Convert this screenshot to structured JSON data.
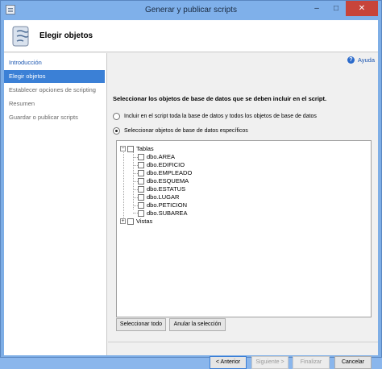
{
  "window": {
    "title": "Generar y publicar scripts",
    "minimize": "–",
    "maximize": "□",
    "close": "✕"
  },
  "header": {
    "title": "Elegir objetos",
    "icon": "script-scroll-icon"
  },
  "sidebar": {
    "items": [
      {
        "label": "Introducción",
        "state": "link"
      },
      {
        "label": "Elegir objetos",
        "state": "active"
      },
      {
        "label": "Establecer opciones de scripting",
        "state": "disabled"
      },
      {
        "label": "Resumen",
        "state": "disabled"
      },
      {
        "label": "Guardar o publicar scripts",
        "state": "disabled"
      }
    ]
  },
  "main": {
    "help_label": "Ayuda",
    "instruction": "Seleccionar los objetos de base de datos que se deben incluir en el script.",
    "option_all": "Incluir en el script toda la base de datos y todos los objetos de base de datos",
    "option_specific": "Seleccionar objetos de base de datos específicos",
    "selected_option": "specific",
    "tree": {
      "tables_label": "Tablas",
      "tables_expander": "−",
      "tables": [
        "dbo.AREA",
        "dbo.EDIFICIO",
        "dbo.EMPLEADO",
        "dbo.ESQUEMA",
        "dbo.ESTATUS",
        "dbo.LUGAR",
        "dbo.PETICION",
        "dbo.SUBAREA"
      ],
      "views_label": "Vistas",
      "views_expander": "+"
    },
    "select_all": "Seleccionar todo",
    "clear_selection": "Anular la selección"
  },
  "footer": {
    "back": "< Anterior",
    "next": "Siguiente >",
    "finish": "Finalizar",
    "cancel": "Cancelar"
  },
  "colors": {
    "accent": "#3b80d6",
    "titlebar": "#7fb0ea",
    "close": "#c7443a",
    "link": "#1a55b0"
  }
}
